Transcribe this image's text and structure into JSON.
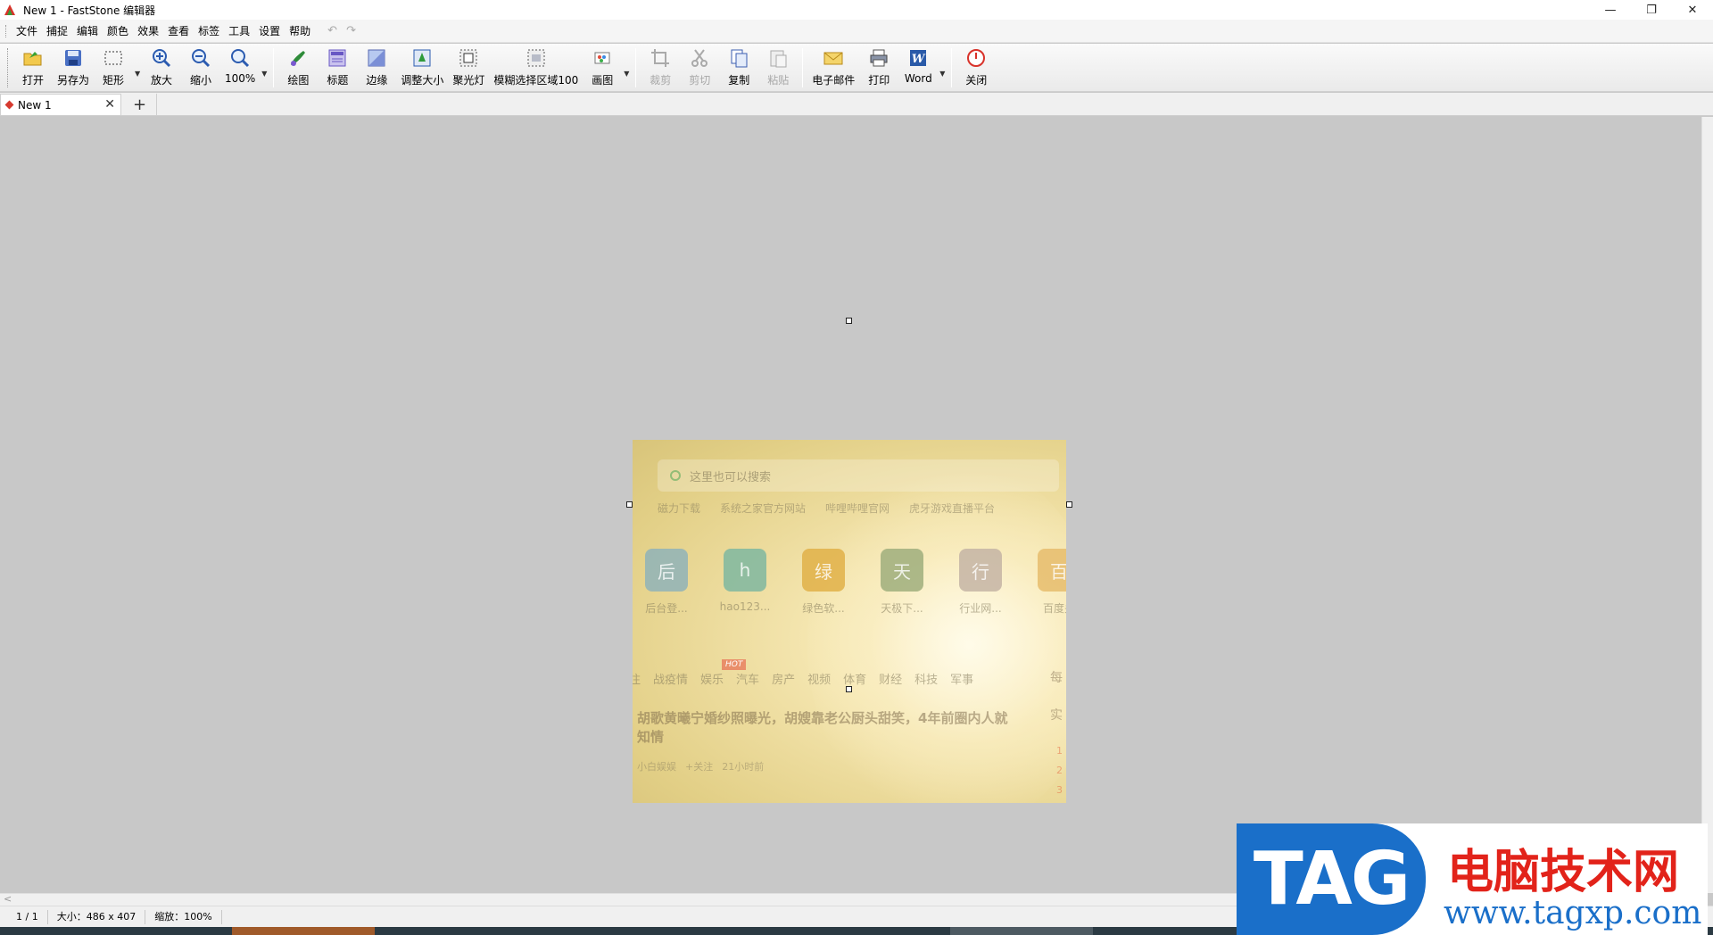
{
  "window": {
    "title": "New 1 - FastStone 编辑器",
    "controls": {
      "minimize": "—",
      "restore": "❐",
      "close": "✕"
    }
  },
  "menubar": {
    "items": [
      "文件",
      "捕捉",
      "编辑",
      "颜色",
      "效果",
      "查看",
      "标签",
      "工具",
      "设置",
      "帮助"
    ],
    "undo_icon": "undo-icon",
    "redo_icon": "redo-icon"
  },
  "toolbar": {
    "open": "打开",
    "save_as": "另存为",
    "rectangle": "矩形",
    "zoom_in": "放大",
    "zoom_out": "缩小",
    "zoom_level": "100%",
    "draw": "绘图",
    "caption": "标题",
    "edge": "边缘",
    "resize": "调整大小",
    "spotlight": "聚光灯",
    "blur_region": "模糊选择区域100",
    "canvas": "画图",
    "crop": "裁剪",
    "cut": "剪切",
    "copy": "复制",
    "paste": "粘贴",
    "email": "电子邮件",
    "print": "打印",
    "word": "Word",
    "close": "关闭"
  },
  "tabs": {
    "active": "New 1",
    "add": "+"
  },
  "image_content": {
    "search_placeholder": "这里也可以搜索",
    "quick_links": [
      "磁力下载",
      "系统之家官方网站",
      "哔哩哔哩官网",
      "虎牙游戏直播平台"
    ],
    "sites": [
      {
        "glyph": "后",
        "name": "后台登...",
        "color": "#8fb3b8"
      },
      {
        "glyph": "h",
        "name": "hao123...",
        "color": "#7fb7a0"
      },
      {
        "glyph": "绿",
        "name": "绿色软...",
        "color": "#e0b048"
      },
      {
        "glyph": "天",
        "name": "天极下...",
        "color": "#9fae7c"
      },
      {
        "glyph": "行",
        "name": "行业网...",
        "color": "#c4b4a4"
      },
      {
        "glyph": "百",
        "name": "百度关",
        "color": "#e6bc6c"
      }
    ],
    "news_tabs": [
      "注",
      "战疫情",
      "娱乐",
      "汽车",
      "房产",
      "视频",
      "体育",
      "财经",
      "科技",
      "军事"
    ],
    "hot_badge": "HOT",
    "headline": "胡歌黄曦宁婚纱照曝光，胡嫂靠老公厨头甜笑，4年前圈内人就知情",
    "meta": [
      "小白娱娱",
      "+关注",
      "21小时前"
    ],
    "side_col": [
      "每",
      "实"
    ],
    "side_nums": [
      "1",
      "2",
      "3"
    ]
  },
  "status": {
    "page": "1 / 1",
    "size": "大小：486 x 407",
    "zoom": "缩放：100%"
  },
  "watermark": {
    "tag": "TAG",
    "title": "电脑技术网",
    "url": "www.tagxp.com"
  }
}
